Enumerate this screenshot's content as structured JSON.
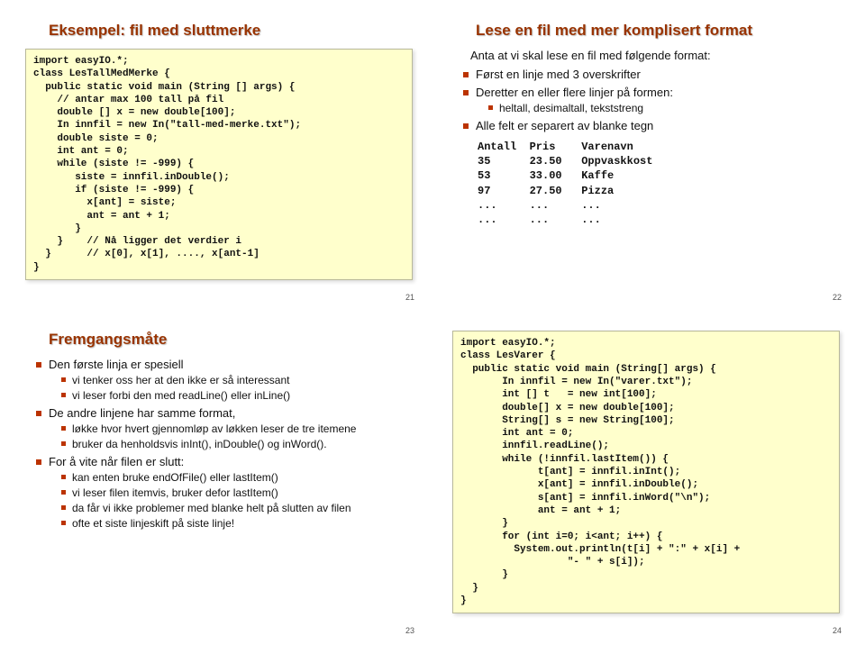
{
  "slides": {
    "s21": {
      "title": "Eksempel: fil med sluttmerke",
      "code": "import easyIO.*;\nclass LesTallMedMerke {\n  public static void main (String [] args) {\n    // antar max 100 tall på fil\n    double [] x = new double[100];\n    In innfil = new In(\"tall-med-merke.txt\");\n    double siste = 0;\n    int ant = 0;\n    while (siste != -999) {\n       siste = innfil.inDouble();\n       if (siste != -999) {\n         x[ant] = siste;\n         ant = ant + 1;\n       }\n    }    // Nå ligger det verdier i\n  }      // x[0], x[1], ...., x[ant-1]\n}",
      "pagenum": "21"
    },
    "s22": {
      "title": "Lese en fil med mer komplisert format",
      "intro": "Anta at vi skal lese en fil med følgende format:",
      "b1": "Først en linje med 3 overskrifter",
      "b2": "Deretter en eller flere linjer på formen:",
      "b2s1": "heltall, desimaltall, tekststreng",
      "b3": "Alle felt er separert av blanke tegn",
      "data": "Antall  Pris    Varenavn\n35      23.50   Oppvaskkost\n53      33.00   Kaffe\n97      27.50   Pizza\n...     ...     ...\n...     ...     ...",
      "pagenum": "22"
    },
    "s23": {
      "title": "Fremgangsmåte",
      "b1": "Den første linja er spesiell",
      "b1s1": "vi tenker oss her at den ikke er så interessant",
      "b1s2": "vi leser forbi den med readLine() eller inLine()",
      "b2": "De andre linjene har samme format,",
      "b2s1": "løkke hvor hvert gjennomløp av løkken leser de tre itemene",
      "b2s2": "bruker da henholdsvis inInt(), inDouble() og inWord().",
      "b3": "For å vite når filen er slutt:",
      "b3s1": "kan enten bruke endOfFile() eller lastItem()",
      "b3s2": "vi leser filen itemvis, bruker defor lastItem()",
      "b3s3": "da får vi ikke problemer med blanke helt på slutten av filen",
      "b3s4": "ofte et siste linjeskift på siste linje!",
      "pagenum": "23"
    },
    "s24": {
      "code": "import easyIO.*;\nclass LesVarer {\n  public static void main (String[] args) {\n       In innfil = new In(\"varer.txt\");\n       int [] t   = new int[100];\n       double[] x = new double[100];\n       String[] s = new String[100];\n       int ant = 0;\n       innfil.readLine();\n       while (!innfil.lastItem()) {\n             t[ant] = innfil.inInt();\n             x[ant] = innfil.inDouble();\n             s[ant] = innfil.inWord(\"\\n\");\n             ant = ant + 1;\n       }\n       for (int i=0; i<ant; i++) {\n         System.out.println(t[i] + \":\" + x[i] +\n                  \"- \" + s[i]);\n       }\n  }\n}",
      "pagenum": "24"
    }
  }
}
